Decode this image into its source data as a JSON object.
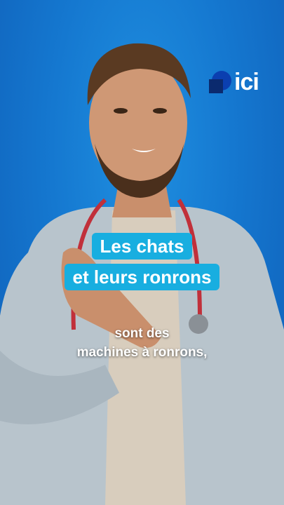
{
  "logo": {
    "text": "ici"
  },
  "title": {
    "line1": "Les chats",
    "line2": "et leurs ronrons"
  },
  "subtitle": {
    "line1": "sont des",
    "line2": "machines à ronrons,"
  },
  "colors": {
    "background": "#1578d0",
    "title_box": "#18aee0",
    "text": "#ffffff"
  }
}
